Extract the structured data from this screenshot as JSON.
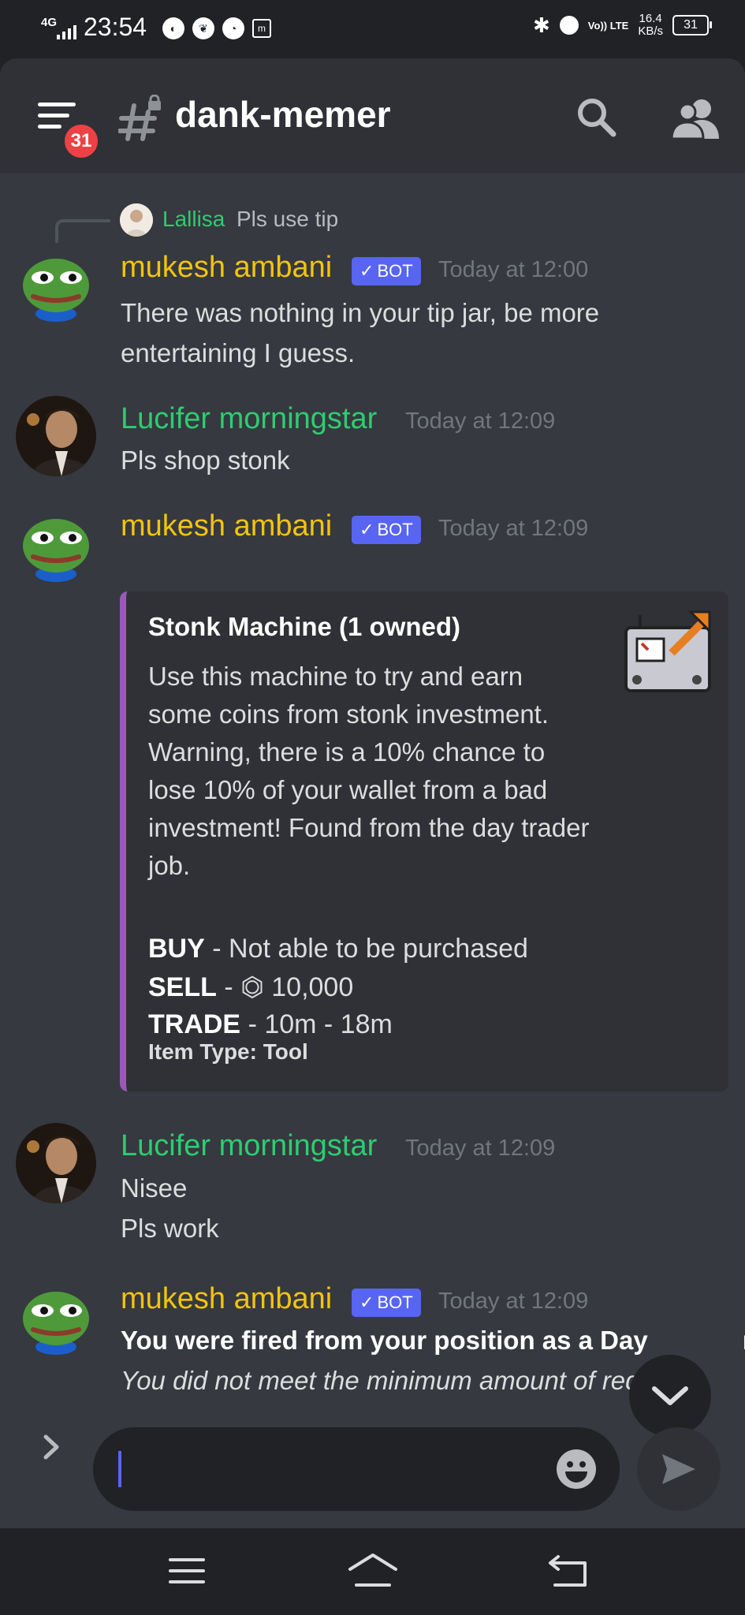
{
  "status_bar": {
    "network": "4G",
    "time": "23:54",
    "volte": "Vo)) LTE",
    "speed_value": "16.4",
    "speed_unit": "KB/s",
    "battery": "31"
  },
  "header": {
    "channel_name": "dank-memer",
    "unread_badge": "31"
  },
  "reply": {
    "name": "Lallisa",
    "text": "Pls use tip"
  },
  "messages": [
    {
      "author": "mukesh ambani",
      "bot_tag": "BOT",
      "timestamp": "Today at 12:00",
      "lines": [
        "There was nothing in your tip jar, be more",
        "entertaining I guess."
      ]
    },
    {
      "author": "Lucifer morningstar",
      "timestamp": "Today at 12:09",
      "lines": [
        "Pls shop stonk"
      ]
    },
    {
      "author": "mukesh ambani",
      "bot_tag": "BOT",
      "timestamp": "Today at 12:09",
      "embed": {
        "title": "Stonk Machine (1 owned)",
        "description": "Use this machine to try and earn some coins from stonk investment. Warning, there is a 10% chance to lose 10% of your wallet from a bad investment! Found from the day trader job.",
        "buy_label": "BUY",
        "buy_value": "- Not able to be purchased",
        "sell_label": "SELL",
        "sell_value": "- ⏣ 10,000",
        "trade_label": "TRADE",
        "trade_value": "- 10m - 18m",
        "item_type": "Item Type: Tool"
      }
    },
    {
      "author": "Lucifer morningstar",
      "timestamp": "Today at 12:09",
      "lines": [
        "Nisee",
        "Pls work"
      ]
    },
    {
      "author": "mukesh ambani",
      "bot_tag": "BOT",
      "timestamp": "Today at 12:09",
      "bold_line": "You were fired from your position as a Day",
      "bold_tail": "r.",
      "italic_line": "You did not meet the minimum amount of required"
    }
  ],
  "colors": {
    "bot_name": "#f1c40f",
    "user_name": "#2ecc71",
    "bot_tag": "#5865f2",
    "embed_accent": "#9b59b6",
    "badge": "#ed4245"
  }
}
